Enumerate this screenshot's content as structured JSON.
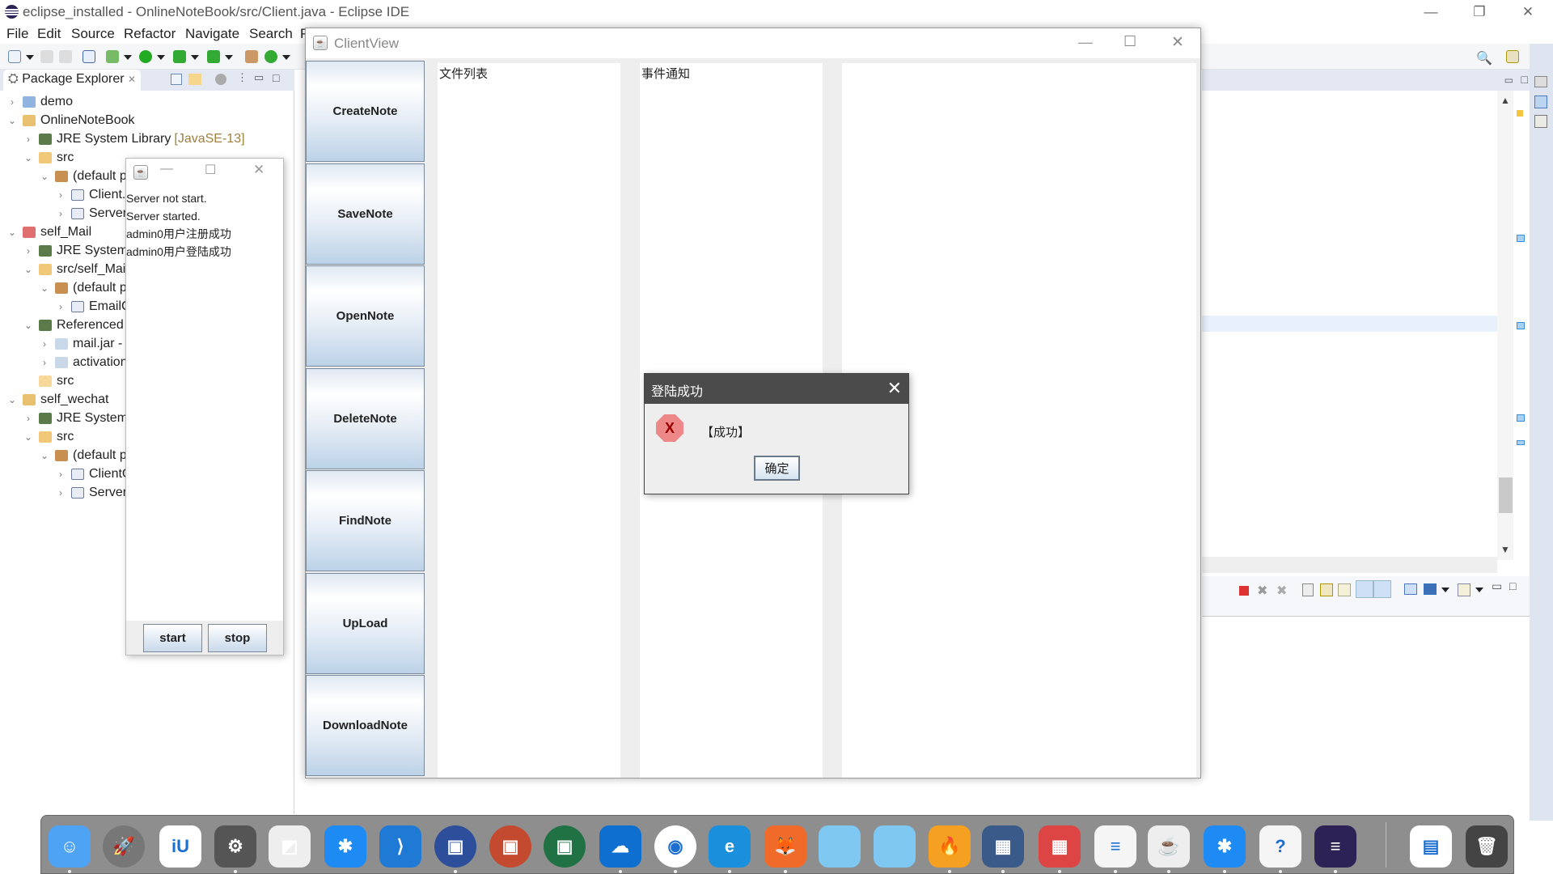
{
  "eclipse": {
    "title": "eclipse_installed - OnlineNoteBook/src/Client.java - Eclipse IDE",
    "menu": [
      "File",
      "Edit",
      "Source",
      "Refactor",
      "Navigate",
      "Search",
      "P"
    ],
    "window_controls": [
      "minimize",
      "restore",
      "close"
    ]
  },
  "package_explorer": {
    "tab_label": "Package Explorer",
    "tree": [
      {
        "label": "demo",
        "level": 0,
        "expanded": false,
        "icon": "project-folder-icon"
      },
      {
        "label": "OnlineNoteBook",
        "level": 0,
        "expanded": true,
        "icon": "project-folder-warning-icon"
      },
      {
        "label": "JRE System Library",
        "decoration": "[JavaSE-13]",
        "level": 1,
        "expanded": false,
        "icon": "library-icon"
      },
      {
        "label": "src",
        "level": 1,
        "expanded": true,
        "icon": "source-folder-icon"
      },
      {
        "label": "(default p",
        "level": 2,
        "expanded": true,
        "icon": "package-icon"
      },
      {
        "label": "Client.",
        "level": 3,
        "expanded": false,
        "icon": "java-file-icon"
      },
      {
        "label": "Server",
        "level": 3,
        "expanded": false,
        "icon": "java-file-icon"
      },
      {
        "label": "self_Mail",
        "level": 0,
        "expanded": true,
        "icon": "project-folder-error-icon"
      },
      {
        "label": "JRE System",
        "level": 1,
        "expanded": false,
        "icon": "library-icon"
      },
      {
        "label": "src/self_Mai",
        "level": 1,
        "expanded": true,
        "icon": "source-folder-icon"
      },
      {
        "label": "(default p",
        "level": 2,
        "expanded": true,
        "icon": "package-icon"
      },
      {
        "label": "EmailC",
        "level": 3,
        "expanded": false,
        "icon": "java-file-icon"
      },
      {
        "label": "Referenced",
        "level": 1,
        "expanded": true,
        "icon": "library-icon"
      },
      {
        "label": "mail.jar - ",
        "level": 2,
        "expanded": false,
        "icon": "jar-icon"
      },
      {
        "label": "activation",
        "level": 2,
        "expanded": false,
        "icon": "jar-icon"
      },
      {
        "label": "src",
        "level": 1,
        "expanded": null,
        "icon": "folder-icon"
      },
      {
        "label": "self_wechat",
        "level": 0,
        "expanded": true,
        "icon": "project-folder-warning-icon"
      },
      {
        "label": "JRE System I",
        "level": 1,
        "expanded": false,
        "icon": "library-icon"
      },
      {
        "label": "src",
        "level": 1,
        "expanded": true,
        "icon": "source-folder-icon"
      },
      {
        "label": "(default p",
        "level": 2,
        "expanded": true,
        "icon": "package-icon"
      },
      {
        "label": "ClientC",
        "level": 3,
        "expanded": false,
        "icon": "java-file-icon"
      },
      {
        "label": "Server",
        "level": 3,
        "expanded": false,
        "icon": "java-file-icon"
      }
    ]
  },
  "server_window": {
    "log": [
      "Server not start.",
      "Server started.",
      "admin0用户注册成功",
      "admin0用户登陆成功"
    ],
    "start_label": "start",
    "stop_label": "stop"
  },
  "client_view": {
    "title": "ClientView",
    "buttons": [
      "CreateNote",
      "SaveNote",
      "OpenNote",
      "DeleteNote",
      "FindNote",
      "UpLoad",
      "DownloadNote"
    ],
    "file_list_label": "文件列表",
    "event_label": "事件通知"
  },
  "dialog": {
    "title": "登陆成功",
    "message": "【成功】",
    "ok_label": "确定"
  },
  "dock": {
    "apps": [
      "Finder",
      "Launchpad",
      "iU",
      "System Preferences",
      "Jump Desktop",
      "Tencent",
      "Visual Studio Code",
      "Word",
      "PowerPoint",
      "Excel",
      "OneDrive",
      "Chrome",
      "Edge",
      "Firefox",
      "Folder",
      "Folder",
      "Security",
      "VirtualBox",
      "Mosaic",
      "TextEdit",
      "Java",
      "Tencent",
      "Help",
      "Eclipse",
      "Preview",
      "Trash"
    ]
  }
}
